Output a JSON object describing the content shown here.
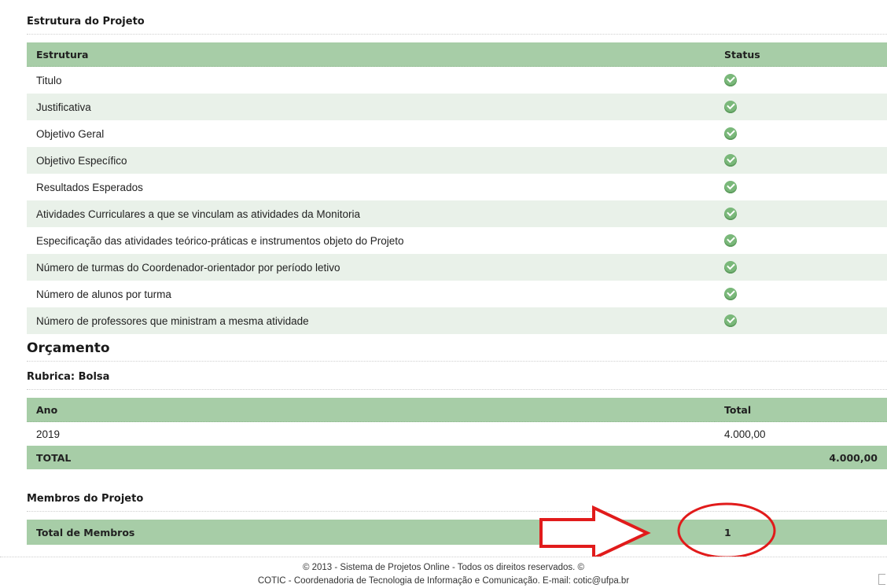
{
  "estrutura": {
    "title": "Estrutura do Projeto",
    "columns": {
      "estrutura": "Estrutura",
      "status": "Status"
    },
    "rows": [
      "Titulo",
      "Justificativa",
      "Objetivo Geral",
      "Objetivo Específico",
      "Resultados Esperados",
      "Atividades Curriculares a que se vinculam as atividades da Monitoria",
      "Especificação das atividades teórico-práticas e instrumentos objeto do Projeto",
      "Número de turmas do Coordenador-orientador por período letivo",
      "Número de alunos por turma",
      "Número de professores que ministram a mesma atividade"
    ],
    "status_icon": "check-circle-icon"
  },
  "orcamento": {
    "title": "Orçamento",
    "rubrica": "Rubrica: Bolsa",
    "columns": {
      "ano": "Ano",
      "total": "Total"
    },
    "rows": [
      {
        "ano": "2019",
        "total": "4.000,00"
      }
    ],
    "total_label": "TOTAL",
    "total_value": "4.000,00"
  },
  "membros": {
    "title": "Membros do Projeto",
    "total_label": "Total de Membros",
    "total_value": "1"
  },
  "footer": {
    "line1": "© 2013 - Sistema de Projetos Online - Todos os direitos reservados. ©",
    "line2": "COTIC - Coordenadoria de Tecnologia de Informação e Comunicação. E-mail: cotic@ufpa.br"
  },
  "colors": {
    "header_green": "#a7cda7",
    "row_alt": "#e9f1e9",
    "annotation_red": "#e11b1b"
  }
}
